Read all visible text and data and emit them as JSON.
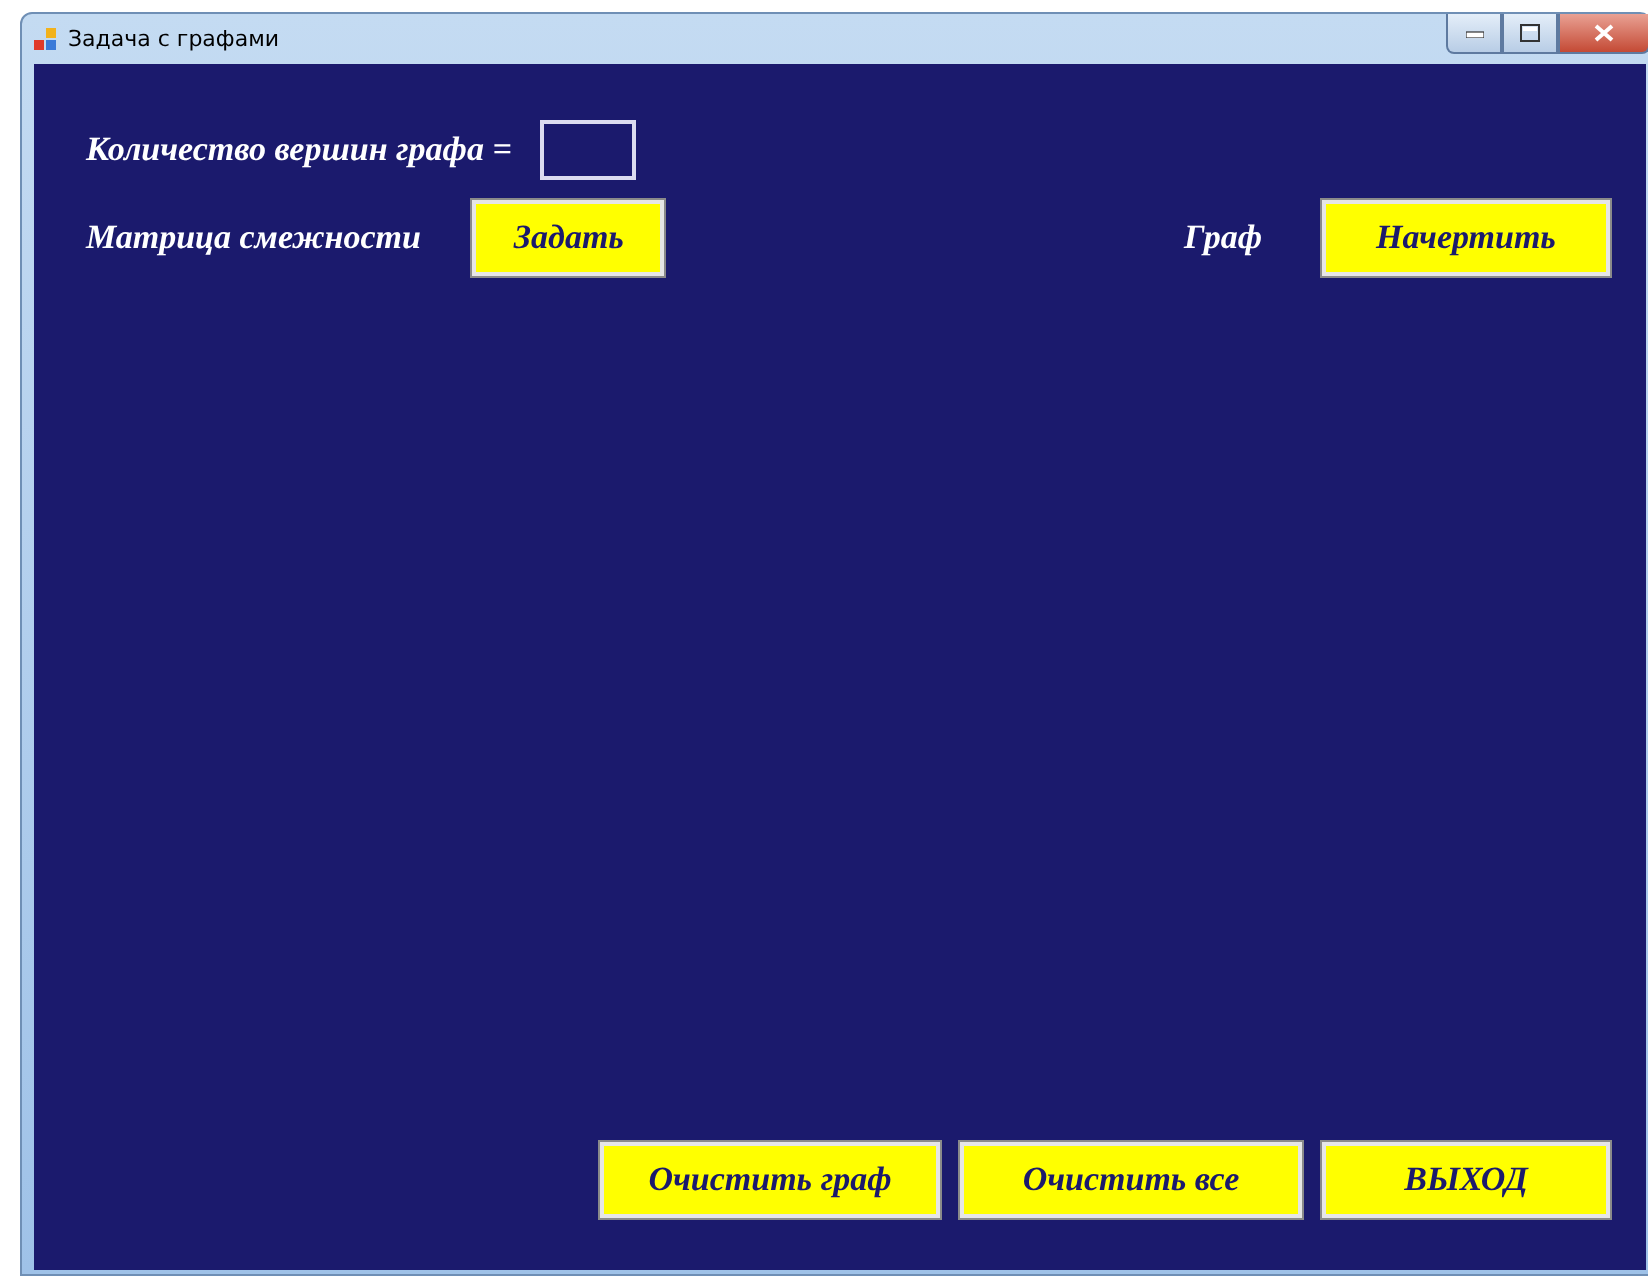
{
  "window": {
    "title": "Задача с графами"
  },
  "vertex_count": {
    "label": "Количество вершин графа ="
  },
  "matrix": {
    "label": "Матрица смежности",
    "button": "Задать"
  },
  "graph": {
    "label": "Граф",
    "button": "Начертить"
  },
  "buttons": [
    {
      "label": "Очистить граф"
    },
    {
      "label": "Очистить все"
    },
    {
      "label": "ВЫХОД"
    }
  ]
}
